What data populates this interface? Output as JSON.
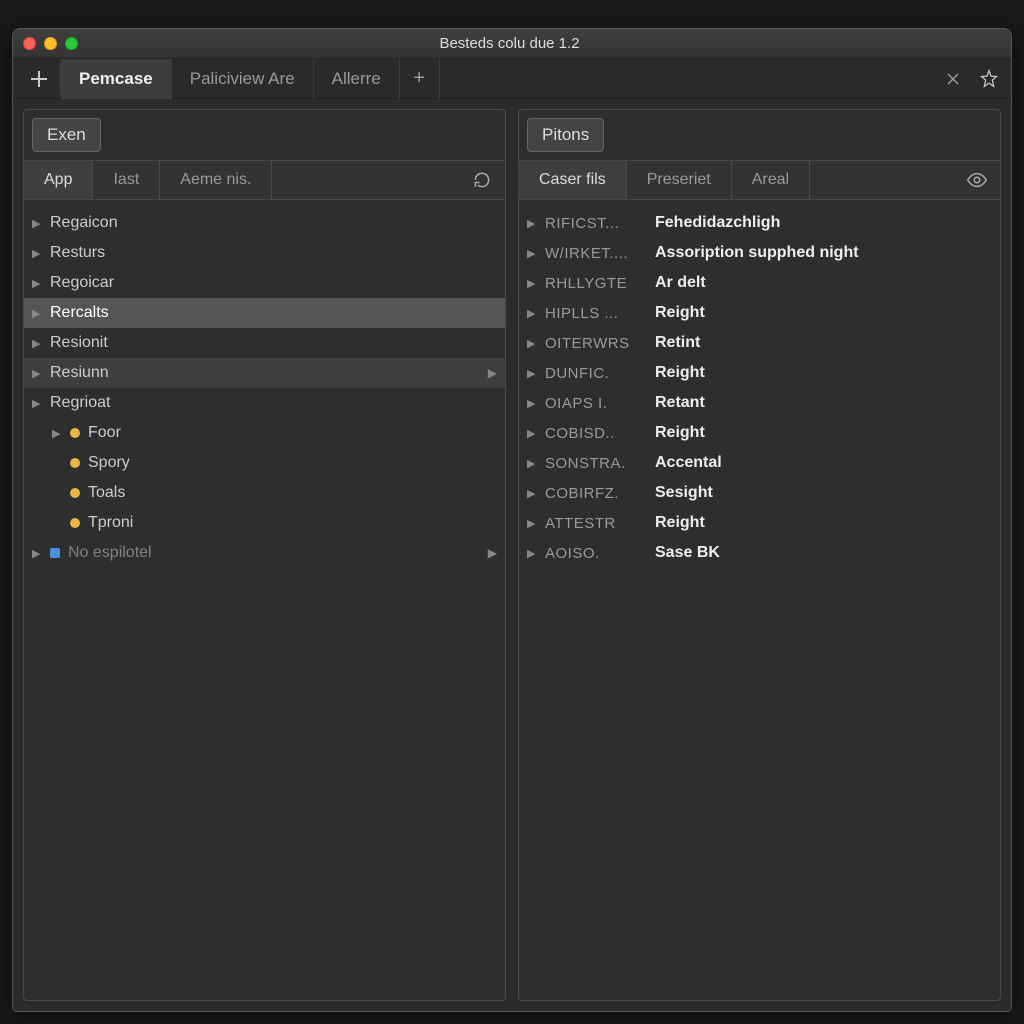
{
  "window": {
    "title": "Besteds colu due 1.2"
  },
  "tabs": {
    "items": [
      {
        "label": "Pemcase",
        "active": true
      },
      {
        "label": "Paliciview Are",
        "active": false
      },
      {
        "label": "Allerre",
        "active": false
      }
    ]
  },
  "left": {
    "headButton": "Exen",
    "subtabs": [
      {
        "label": "App",
        "active": true
      },
      {
        "label": "Iast",
        "active": false
      },
      {
        "label": "Aeme nis.",
        "active": false
      }
    ],
    "tree": [
      {
        "label": "Regaicon",
        "caret": true
      },
      {
        "label": "Resturs",
        "caret": true
      },
      {
        "label": "Regoicar",
        "caret": true
      },
      {
        "label": "Rercalts",
        "caret": true,
        "selected": true
      },
      {
        "label": "Resionit",
        "caret": true
      },
      {
        "label": "Resiunn",
        "caret": true,
        "selected2": true,
        "endCaret": true
      },
      {
        "label": "Regrioat",
        "caret": true
      }
    ],
    "children": [
      {
        "label": "Foor",
        "dot": "yellow"
      },
      {
        "label": "Spory",
        "dot": "yellow"
      },
      {
        "label": "Toals",
        "dot": "yellow"
      },
      {
        "label": "Tproni",
        "dot": "yellow"
      }
    ],
    "lastRow": {
      "label": "No espilotel",
      "icon": "blue",
      "endCaret": true
    }
  },
  "right": {
    "headButton": "Pitons",
    "subtabs": [
      {
        "label": "Caser fils",
        "active": true
      },
      {
        "label": "Preseriet",
        "active": false
      },
      {
        "label": "Areal",
        "active": false
      }
    ],
    "rows": [
      {
        "k": "RIFICST...",
        "v": "Fehedidazchligh"
      },
      {
        "k": "W/IRKET....",
        "v": "Assoription supphed night"
      },
      {
        "k": "RHLLYGTE",
        "v": "Ar delt"
      },
      {
        "k": "HIPLLS ...",
        "v": "Reight"
      },
      {
        "k": "OITERWRS",
        "v": "Retint"
      },
      {
        "k": "DUNFIC.",
        "v": "Reight"
      },
      {
        "k": "OIAPS I.",
        "v": "Retant"
      },
      {
        "k": "COBISD..",
        "v": "Reight"
      },
      {
        "k": "SONSTRA.",
        "v": "Accental"
      },
      {
        "k": "COBIRFZ.",
        "v": "Sesight"
      },
      {
        "k": "ATTESTR",
        "v": "Reight"
      },
      {
        "k": "AOISO.",
        "v": "Sase BK"
      }
    ]
  }
}
